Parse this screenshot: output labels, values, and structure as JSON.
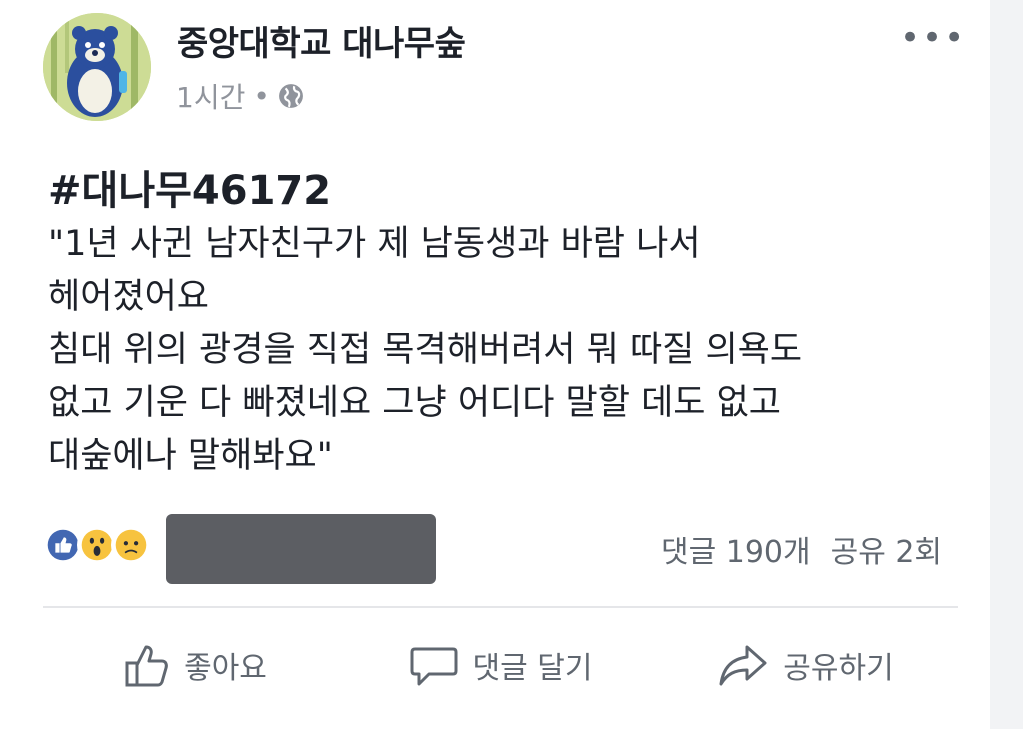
{
  "post": {
    "page_name": "중앙대학교 대나무숲",
    "time": "1시간",
    "separator": "•",
    "privacy_icon": "globe-icon",
    "more_label": "•••",
    "hashtag": "#대나무46172",
    "body_lines": [
      "\"1년 사귄 남자친구가 제 남동생과 바람 나서",
      "헤어졌어요",
      "침대 위의 광경을 직접 목격해버려서 뭐 따질 의욕도",
      "없고 기운 다 빠졌네요 그냥 어디다 말할 데도 없고",
      "대숲에나 말해봐요\""
    ],
    "reaction_icons": [
      "like-icon",
      "wow-icon",
      "sad-icon"
    ],
    "comment_count": "댓글 190개",
    "share_count": "공유 2회"
  },
  "actions": {
    "like_label": "좋아요",
    "comment_label": "댓글 달기",
    "share_label": "공유하기"
  },
  "colors": {
    "like_blue": "#4267b2",
    "reaction_yellow": "#f7c33f",
    "muted_text": "#606770",
    "redaction": "#5c5e63"
  }
}
